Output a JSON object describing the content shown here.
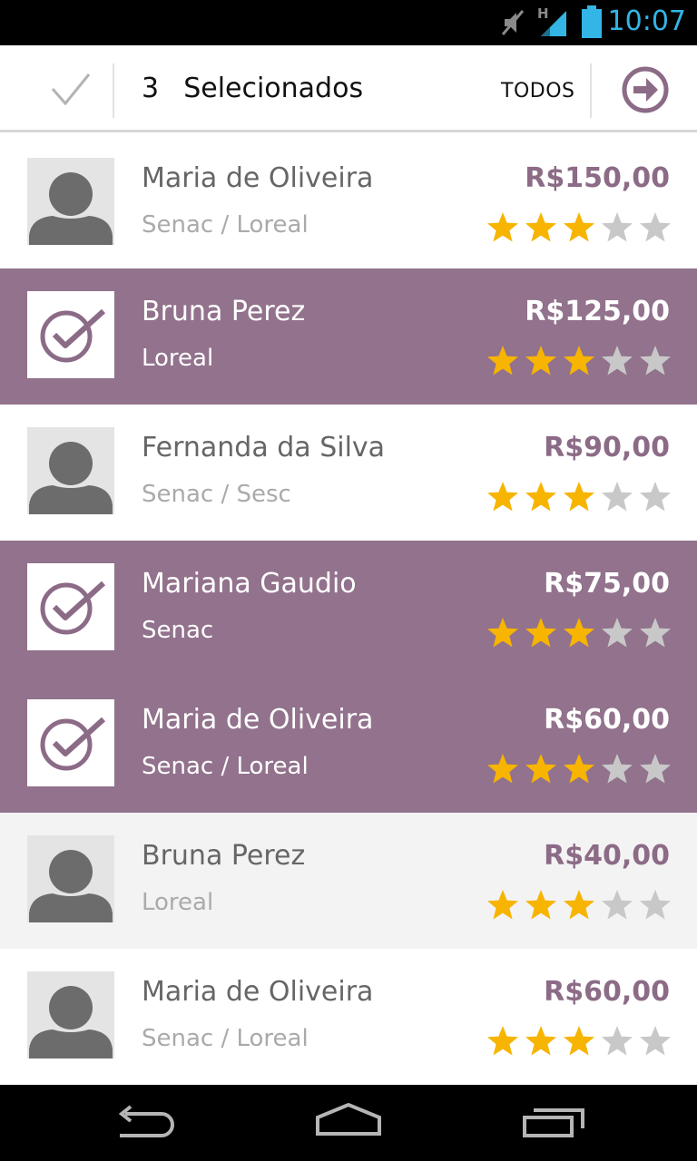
{
  "status_bar": {
    "time": "10:07",
    "network_label": "H",
    "icons": [
      "mute-icon",
      "signal-icon",
      "battery-icon"
    ],
    "accent_color": "#33b5e5"
  },
  "header": {
    "count": "3",
    "title": "Selecionados",
    "select_all_label": "TODOS",
    "icons": [
      "check-icon",
      "arrow-right-circle-icon"
    ],
    "accent_color": "#8c6b86"
  },
  "list": {
    "items": [
      {
        "name": "Maria de Oliveira",
        "org": "Senac / Loreal",
        "price": "R$150,00",
        "rating": 3,
        "max_rating": 5,
        "selected": false,
        "style": "plain"
      },
      {
        "name": "Bruna Perez",
        "org": "Loreal",
        "price": "R$125,00",
        "rating": 3,
        "max_rating": 5,
        "selected": true,
        "style": "selected"
      },
      {
        "name": "Fernanda da Silva",
        "org": "Senac / Sesc",
        "price": "R$90,00",
        "rating": 3,
        "max_rating": 5,
        "selected": false,
        "style": "plain"
      },
      {
        "name": "Mariana Gaudio",
        "org": "Senac",
        "price": "R$75,00",
        "rating": 3,
        "max_rating": 5,
        "selected": true,
        "style": "selected"
      },
      {
        "name": "Maria de Oliveira",
        "org": "Senac / Loreal",
        "price": "R$60,00",
        "rating": 3,
        "max_rating": 5,
        "selected": true,
        "style": "selected"
      },
      {
        "name": "Bruna Perez",
        "org": "Loreal",
        "price": "R$40,00",
        "rating": 3,
        "max_rating": 5,
        "selected": false,
        "style": "alt"
      },
      {
        "name": "Maria de Oliveira",
        "org": "Senac / Loreal",
        "price": "R$60,00",
        "rating": 3,
        "max_rating": 5,
        "selected": false,
        "style": "plain"
      }
    ],
    "colors": {
      "selected_bg": "#92728c",
      "star_filled": "#f7b400",
      "star_empty": "#c8c8c8",
      "price": "#8c6b86"
    }
  },
  "nav_bar": {
    "icons": [
      "back-icon",
      "home-icon",
      "recent-apps-icon"
    ]
  }
}
